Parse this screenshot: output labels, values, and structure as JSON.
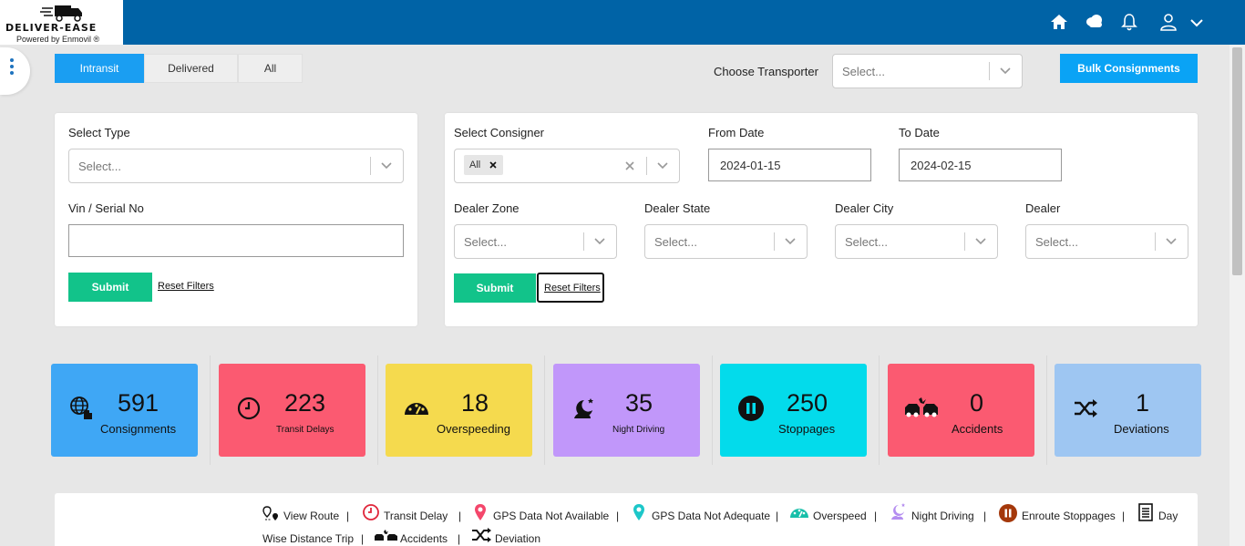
{
  "brand": {
    "name": "DELIVER-EASE",
    "powered": "Powered by Enmovil ®"
  },
  "header_icons": [
    "home-icon",
    "cloud-icon",
    "bell-icon",
    "user-icon",
    "chevron-down-icon"
  ],
  "tabs": [
    {
      "label": "Intransit",
      "active": true
    },
    {
      "label": "Delivered",
      "active": false
    },
    {
      "label": "All",
      "active": false
    }
  ],
  "transporter": {
    "label": "Choose Transporter",
    "placeholder": "Select..."
  },
  "bulk_button": "Bulk Consignments",
  "left_filters": {
    "type_label": "Select Type",
    "type_placeholder": "Select...",
    "vin_label": "Vin / Serial No",
    "vin_value": "",
    "submit": "Submit",
    "reset": "Reset Filters"
  },
  "right_filters": {
    "consigner_label": "Select Consigner",
    "consigner_chip": "All",
    "from_label": "From Date",
    "from_value": "2024-01-15",
    "to_label": "To Date",
    "to_value": "2024-02-15",
    "zone_label": "Dealer Zone",
    "state_label": "Dealer State",
    "city_label": "Dealer City",
    "dealer_label": "Dealer",
    "placeholder": "Select...",
    "submit": "Submit",
    "reset": "Reset Filters"
  },
  "stats": [
    {
      "value": "591",
      "label": "Consignments",
      "color": "#3fa7f5",
      "icon": "globe-hand-icon"
    },
    {
      "value": "223",
      "label": "Transit Delays",
      "color": "#fb5a71",
      "icon": "clock-icon"
    },
    {
      "value": "18",
      "label": "Overspeeding",
      "color": "#f5da4e",
      "icon": "speedometer-icon"
    },
    {
      "value": "35",
      "label": "Night Driving",
      "color": "#c197fa",
      "icon": "moon-icon"
    },
    {
      "value": "250",
      "label": "Stoppages",
      "color": "#03dbeb",
      "icon": "pause-icon"
    },
    {
      "value": "0",
      "label": "Accidents",
      "color": "#fb5a71",
      "icon": "car-crash-icon"
    },
    {
      "value": "1",
      "label": "Deviations",
      "color": "#9ec6f2",
      "icon": "shuffle-icon"
    }
  ],
  "legend": {
    "view_route": "View Route",
    "transit_delay": "Transit Delay",
    "gps_na": "GPS Data Not Available",
    "gps_nad": "GPS Data Not Adequate",
    "overspeed": "Overspeed",
    "night_driving": "Night Driving",
    "enroute": "Enroute Stoppages",
    "day": "Day",
    "wise_distance": "Wise Distance Trip",
    "accidents": "Accidents",
    "deviation": "Deviation",
    "separator": "|"
  }
}
